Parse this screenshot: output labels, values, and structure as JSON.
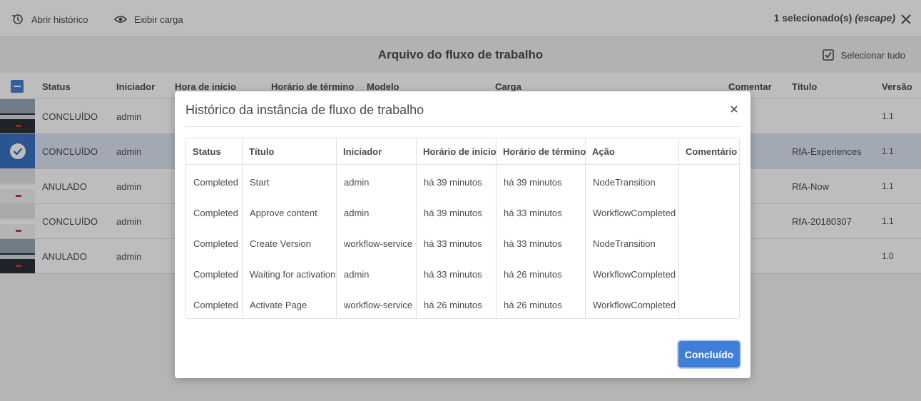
{
  "action_bar": {
    "open_history_label": "Abrir histórico",
    "show_payload_label": "Exibir carga",
    "selection_count": "1 selecionado(s)",
    "escape_hint": "(escape)"
  },
  "page": {
    "title": "Arquivo do fluxo de trabalho",
    "select_all_label": "Selecionar tudo"
  },
  "grid": {
    "headers": {
      "status": "Status",
      "initiator": "Iniciador",
      "start_time": "Hora de início",
      "end_time": "Horário de término",
      "model": "Modelo",
      "payload": "Carga",
      "comment": "Comentar",
      "title": "Título",
      "version": "Versão"
    },
    "rows": [
      {
        "status": "CONCLUÍDO",
        "initiator": "admin",
        "title": "",
        "version": "1.1",
        "thumb": "dark",
        "selected": false
      },
      {
        "status": "CONCLUÍDO",
        "initiator": "admin",
        "title": "RfA-Experiences",
        "version": "1.1",
        "thumb": "dark",
        "selected": true
      },
      {
        "status": "ANULADO",
        "initiator": "admin",
        "title": "RfA-Now",
        "version": "1.1",
        "thumb": "white",
        "selected": false
      },
      {
        "status": "CONCLUÍDO",
        "initiator": "admin",
        "title": "RfA-20180307",
        "version": "1.1",
        "thumb": "white",
        "selected": false
      },
      {
        "status": "ANULADO",
        "initiator": "admin",
        "title": "",
        "version": "1.0",
        "thumb": "dark",
        "selected": false
      }
    ]
  },
  "modal": {
    "title": "Histórico da instância de fluxo de trabalho",
    "done_label": "Concluído",
    "headers": {
      "status": "Status",
      "title": "Título",
      "initiator": "Iniciador",
      "start_time": "Horário de início",
      "end_time": "Horário de término",
      "action": "Ação",
      "comment": "Comentário"
    },
    "rows": [
      {
        "status": "Completed",
        "title": "Start",
        "initiator": "admin",
        "start_time": "há 39 minutos",
        "end_time": "há 39 minutos",
        "action": "NodeTransition",
        "comment": ""
      },
      {
        "status": "Completed",
        "title": "Approve content",
        "initiator": "admin",
        "start_time": "há 39 minutos",
        "end_time": "há 33 minutos",
        "action": "WorkflowCompleted",
        "comment": ""
      },
      {
        "status": "Completed",
        "title": "Create Version",
        "initiator": "workflow-service",
        "start_time": "há 33 minutos",
        "end_time": "há 33 minutos",
        "action": "NodeTransition",
        "comment": ""
      },
      {
        "status": "Completed",
        "title": "Waiting for activation",
        "initiator": "admin",
        "start_time": "há 33 minutos",
        "end_time": "há 26 minutos",
        "action": "WorkflowCompleted",
        "comment": ""
      },
      {
        "status": "Completed",
        "title": "Activate Page",
        "initiator": "workflow-service",
        "start_time": "há 26 minutos",
        "end_time": "há 26 minutos",
        "action": "WorkflowCompleted",
        "comment": ""
      }
    ]
  },
  "colors": {
    "accent": "#3f7fd8",
    "selected_row": "#dbe4f3",
    "text": "#4b4b4b"
  }
}
